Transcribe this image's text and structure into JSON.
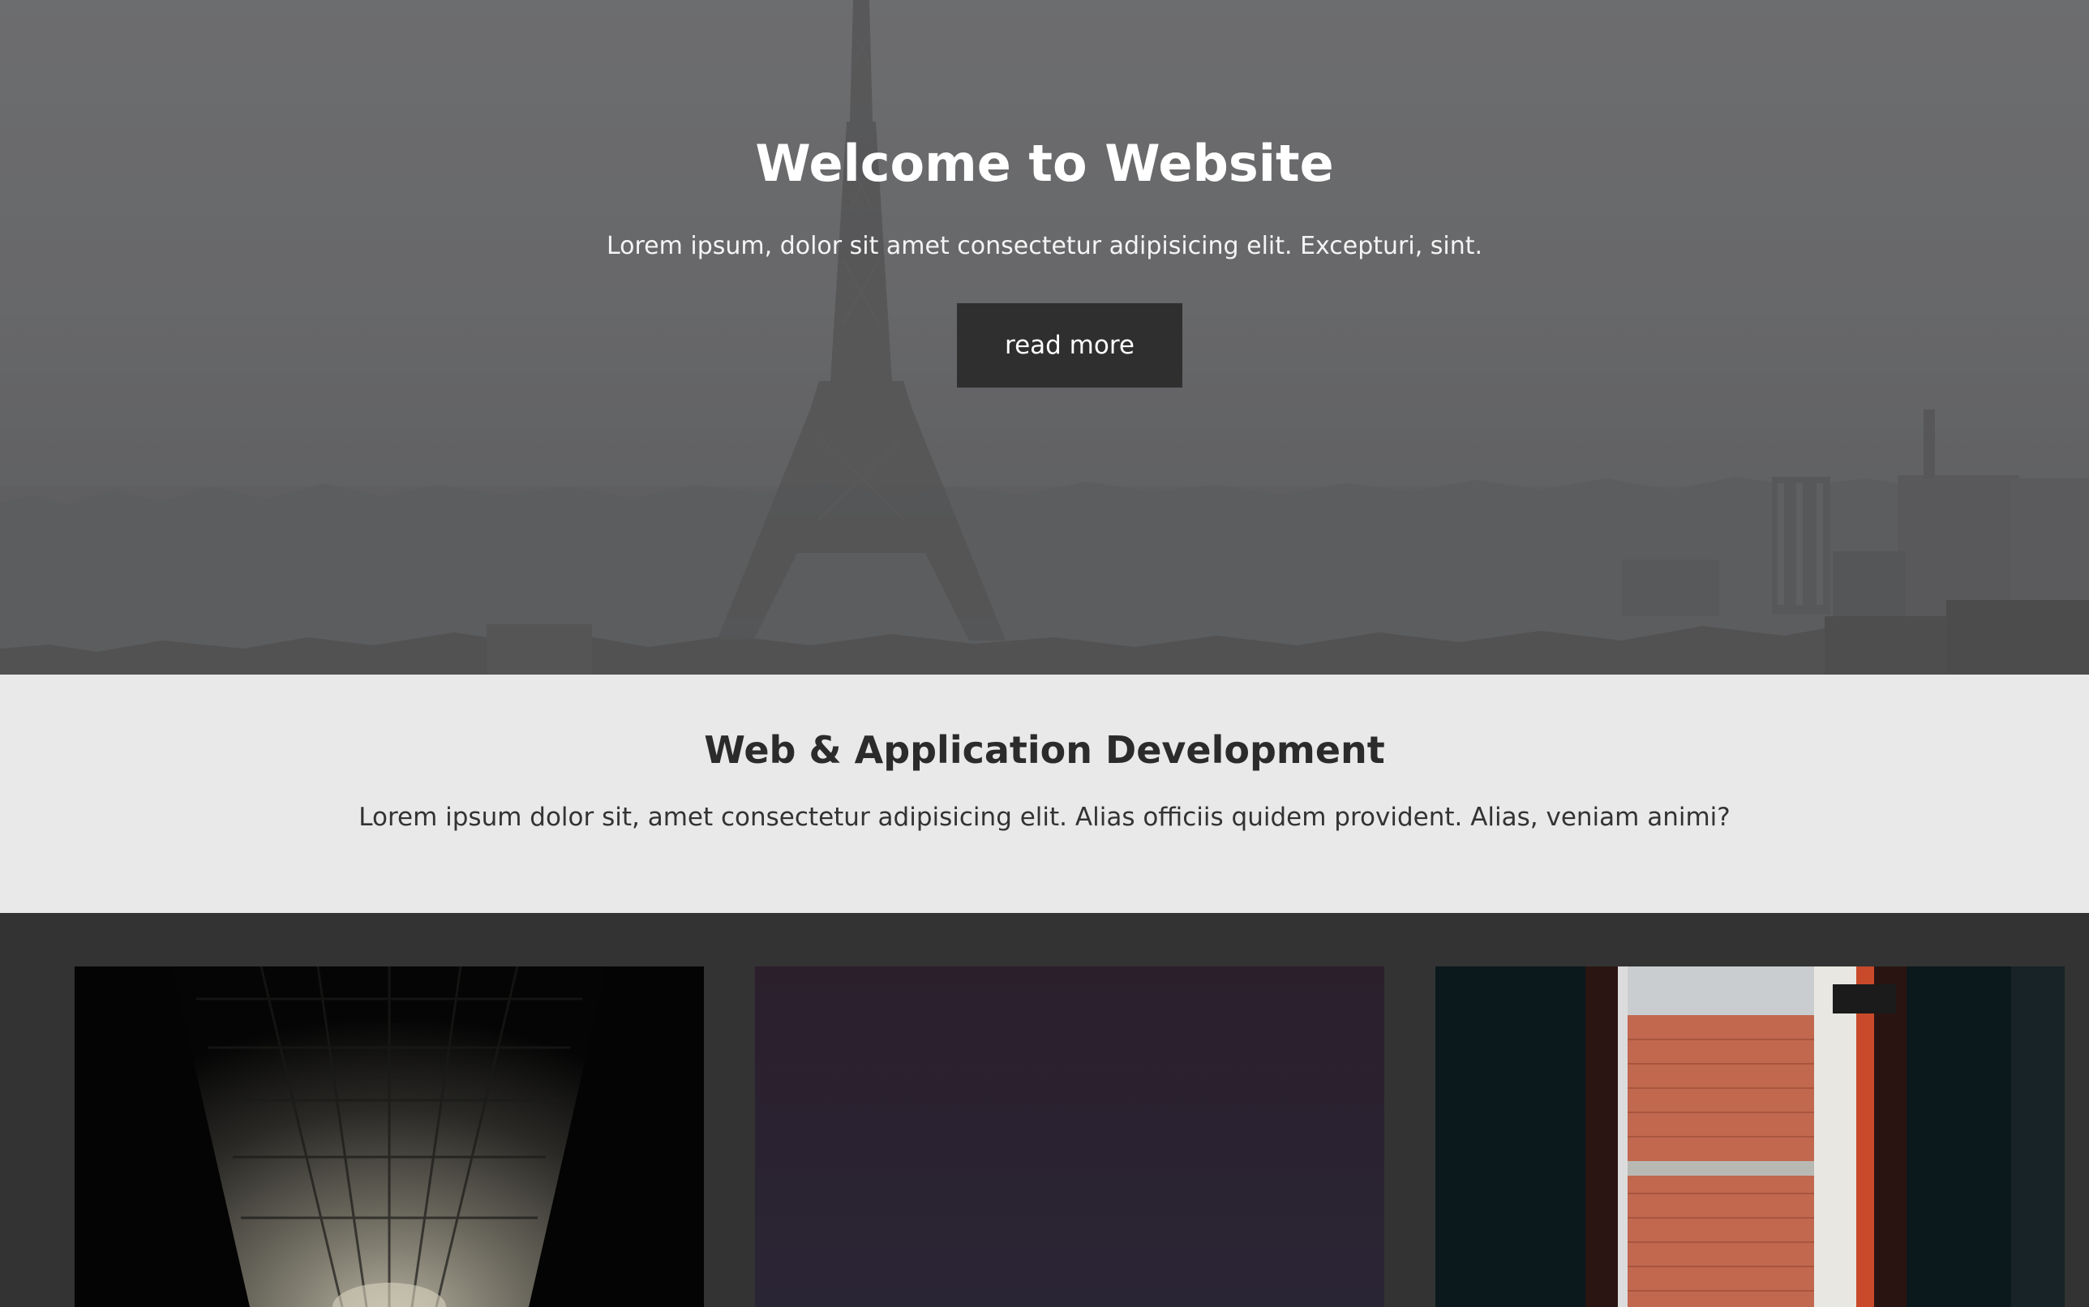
{
  "hero": {
    "title": "Welcome to Website",
    "subtitle": "Lorem ipsum, dolor sit amet consectetur adipisicing elit. Excepturi, sint.",
    "button_label": "read more",
    "background_image": "eiffel-tower-city-skyline"
  },
  "intro": {
    "title": "Web & Application Development",
    "text": "Lorem ipsum dolor sit, amet consectetur adipisicing elit. Alias officiis quidem provident. Alias, veniam animi?"
  },
  "cards": [
    {
      "image": "brick-tunnel-photo"
    },
    {
      "image": "purple-gradient-photo"
    },
    {
      "image": "brick-wall-window-photo"
    }
  ],
  "colors": {
    "hero_overlay": "#666768",
    "button_bg": "#2f2f2f",
    "section_bg": "#e9e9e9",
    "cards_bg": "#333333",
    "heading_dark": "#2b2b2b"
  }
}
